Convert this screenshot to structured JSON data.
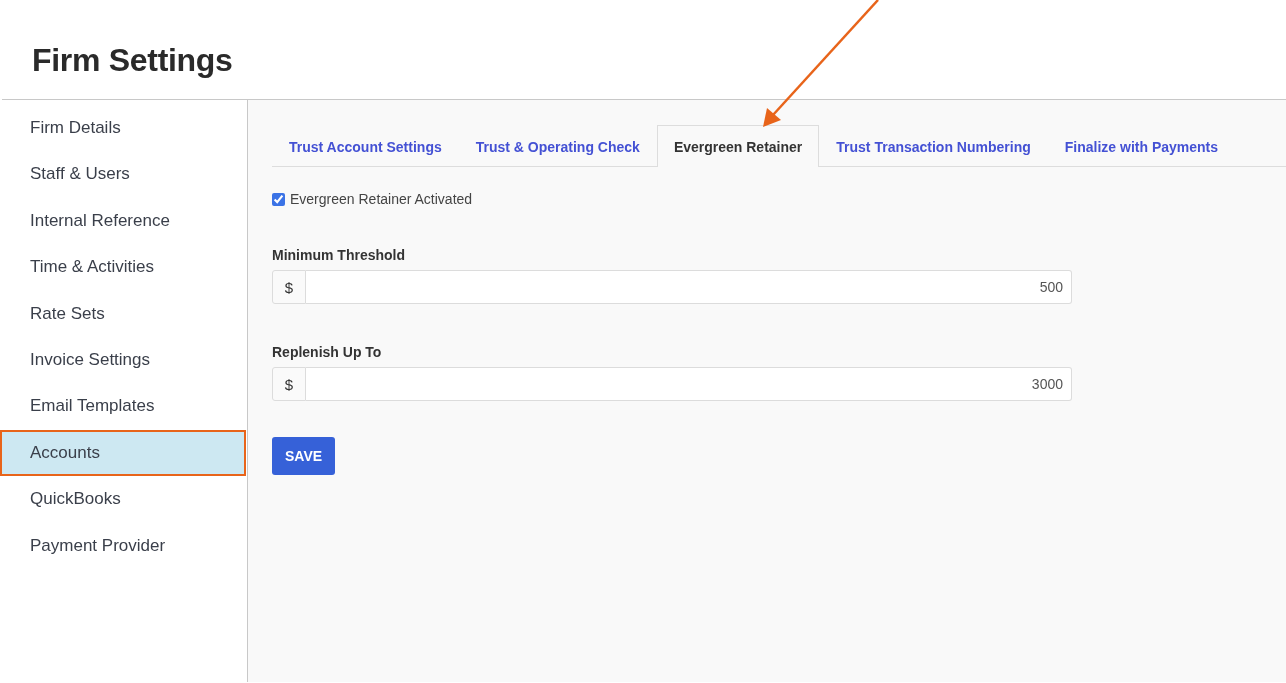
{
  "page": {
    "title": "Firm Settings"
  },
  "sidebar": {
    "items": [
      {
        "label": "Firm Details",
        "selected": false
      },
      {
        "label": "Staff & Users",
        "selected": false
      },
      {
        "label": "Internal Reference",
        "selected": false
      },
      {
        "label": "Time & Activities",
        "selected": false
      },
      {
        "label": "Rate Sets",
        "selected": false
      },
      {
        "label": "Invoice Settings",
        "selected": false
      },
      {
        "label": "Email Templates",
        "selected": false
      },
      {
        "label": "Accounts",
        "selected": true
      },
      {
        "label": "QuickBooks",
        "selected": false
      },
      {
        "label": "Payment Provider",
        "selected": false
      }
    ]
  },
  "tabs": [
    {
      "label": "Trust Account Settings",
      "selected": false
    },
    {
      "label": "Trust & Operating Check",
      "selected": false
    },
    {
      "label": "Evergreen Retainer",
      "selected": true
    },
    {
      "label": "Trust Transaction Numbering",
      "selected": false
    },
    {
      "label": "Finalize with Payments",
      "selected": false
    }
  ],
  "activated": {
    "label": "Evergreen Retainer Activated",
    "checked": true
  },
  "fields": [
    {
      "label": "Minimum Threshold",
      "prefix": "$",
      "value": "500"
    },
    {
      "label": "Replenish Up To",
      "prefix": "$",
      "value": "3000"
    }
  ],
  "save_button": "SAVE"
}
